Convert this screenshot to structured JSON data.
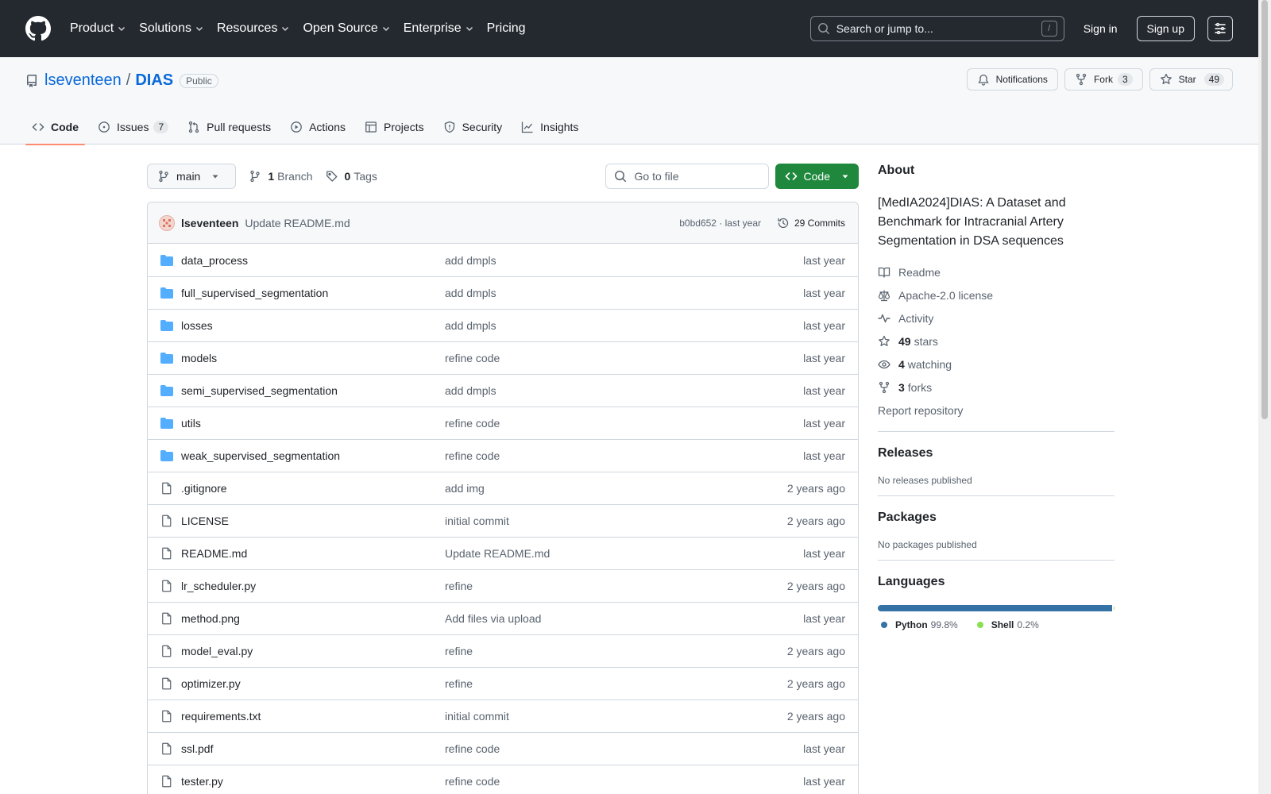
{
  "header": {
    "nav": [
      {
        "label": "Product",
        "dropdown": true
      },
      {
        "label": "Solutions",
        "dropdown": true
      },
      {
        "label": "Resources",
        "dropdown": true
      },
      {
        "label": "Open Source",
        "dropdown": true
      },
      {
        "label": "Enterprise",
        "dropdown": true
      },
      {
        "label": "Pricing",
        "dropdown": false
      }
    ],
    "search_placeholder": "Search or jump to...",
    "search_key": "/",
    "signin": "Sign in",
    "signup": "Sign up"
  },
  "repo": {
    "owner": "lseventeen",
    "separator": "/",
    "name": "DIAS",
    "visibility": "Public",
    "notifications_label": "Notifications",
    "fork_label": "Fork",
    "fork_count": "3",
    "star_label": "Star",
    "star_count": "49",
    "tabs": [
      {
        "label": "Code",
        "icon": "code-icon",
        "active": true,
        "count": ""
      },
      {
        "label": "Issues",
        "icon": "issue-icon",
        "active": false,
        "count": "7"
      },
      {
        "label": "Pull requests",
        "icon": "pull-request-icon",
        "active": false,
        "count": ""
      },
      {
        "label": "Actions",
        "icon": "play-icon",
        "active": false,
        "count": ""
      },
      {
        "label": "Projects",
        "icon": "table-icon",
        "active": false,
        "count": ""
      },
      {
        "label": "Security",
        "icon": "shield-icon",
        "active": false,
        "count": ""
      },
      {
        "label": "Insights",
        "icon": "graph-icon",
        "active": false,
        "count": ""
      }
    ]
  },
  "toolbar": {
    "branch": "main",
    "branch_count": "1",
    "branch_label": "Branch",
    "tag_count": "0",
    "tag_label": "Tags",
    "goto_placeholder": "Go to file",
    "code_button": "Code"
  },
  "latest_commit": {
    "author": "lseventeen",
    "message": "Update README.md",
    "hash_time": "b0bd652 · last year",
    "commits_label": "29 Commits"
  },
  "files": [
    {
      "name": "data_process",
      "type": "dir",
      "message": "add dmpls",
      "date": "last year"
    },
    {
      "name": "full_supervised_segmentation",
      "type": "dir",
      "message": "add dmpls",
      "date": "last year"
    },
    {
      "name": "losses",
      "type": "dir",
      "message": "add dmpls",
      "date": "last year"
    },
    {
      "name": "models",
      "type": "dir",
      "message": "refine code",
      "date": "last year"
    },
    {
      "name": "semi_supervised_segmentation",
      "type": "dir",
      "message": "add dmpls",
      "date": "last year"
    },
    {
      "name": "utils",
      "type": "dir",
      "message": "refine code",
      "date": "last year"
    },
    {
      "name": "weak_supervised_segmentation",
      "type": "dir",
      "message": "refine code",
      "date": "last year"
    },
    {
      "name": ".gitignore",
      "type": "file",
      "message": "add img",
      "date": "2 years ago"
    },
    {
      "name": "LICENSE",
      "type": "file",
      "message": "initial commit",
      "date": "2 years ago"
    },
    {
      "name": "README.md",
      "type": "file",
      "message": "Update README.md",
      "date": "last year"
    },
    {
      "name": "lr_scheduler.py",
      "type": "file",
      "message": "refine",
      "date": "2 years ago"
    },
    {
      "name": "method.png",
      "type": "file",
      "message": "Add files via upload",
      "date": "last year"
    },
    {
      "name": "model_eval.py",
      "type": "file",
      "message": "refine",
      "date": "2 years ago"
    },
    {
      "name": "optimizer.py",
      "type": "file",
      "message": "refine",
      "date": "2 years ago"
    },
    {
      "name": "requirements.txt",
      "type": "file",
      "message": "initial commit",
      "date": "2 years ago"
    },
    {
      "name": "ssl.pdf",
      "type": "file",
      "message": "refine code",
      "date": "last year"
    },
    {
      "name": "tester.py",
      "type": "file",
      "message": "refine code",
      "date": "last year"
    }
  ],
  "about": {
    "heading": "About",
    "description": "[MedIA2024]DIAS: A Dataset and Benchmark for Intracranial Artery Segmentation in DSA sequences",
    "items": [
      {
        "icon": "book-icon",
        "bold": "",
        "text": "Readme"
      },
      {
        "icon": "law-icon",
        "bold": "",
        "text": "Apache-2.0 license"
      },
      {
        "icon": "pulse-icon",
        "bold": "",
        "text": "Activity"
      },
      {
        "icon": "star-icon",
        "bold": "49",
        "text": "stars"
      },
      {
        "icon": "eye-icon",
        "bold": "4",
        "text": "watching"
      },
      {
        "icon": "fork-icon",
        "bold": "3",
        "text": "forks"
      }
    ],
    "report": "Report repository"
  },
  "releases": {
    "heading": "Releases",
    "text": "No releases published"
  },
  "packages": {
    "heading": "Packages",
    "text": "No packages published"
  },
  "languages": {
    "heading": "Languages",
    "items": [
      {
        "name": "Python",
        "percent": "99.8%",
        "value": 99.8,
        "color": "#3572A5"
      },
      {
        "name": "Shell",
        "percent": "0.2%",
        "value": 0.2,
        "color": "#89e051"
      }
    ]
  }
}
